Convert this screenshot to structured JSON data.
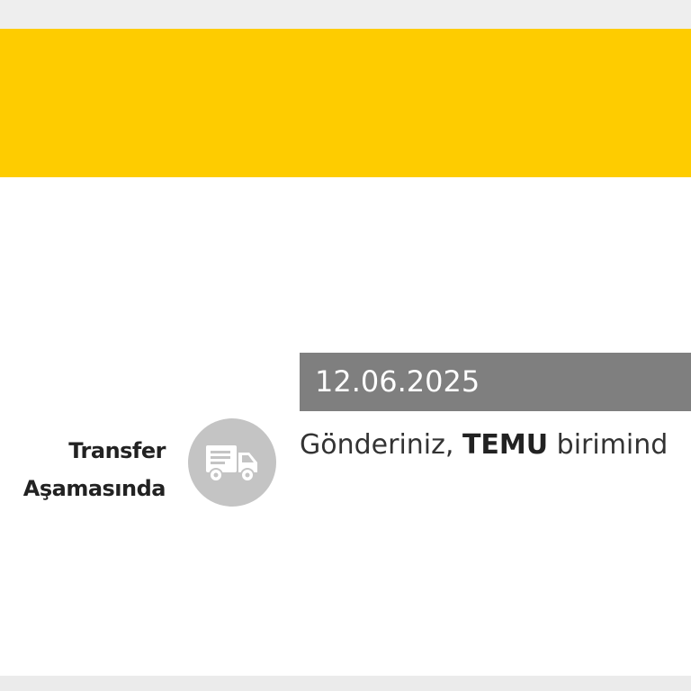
{
  "colors": {
    "banner": "#fecc00",
    "date_bar": "#7f7f7f",
    "icon_circle": "#c4c4c4",
    "label_text": "#222222"
  },
  "status": {
    "label_line1": "Transfer",
    "label_line2": "Aşamasında",
    "icon": "delivery-truck-icon"
  },
  "event": {
    "date": "12.06.2025",
    "message_prefix": "Gönderiniz, ",
    "message_unit": "TEMU",
    "message_suffix": " birimind"
  }
}
